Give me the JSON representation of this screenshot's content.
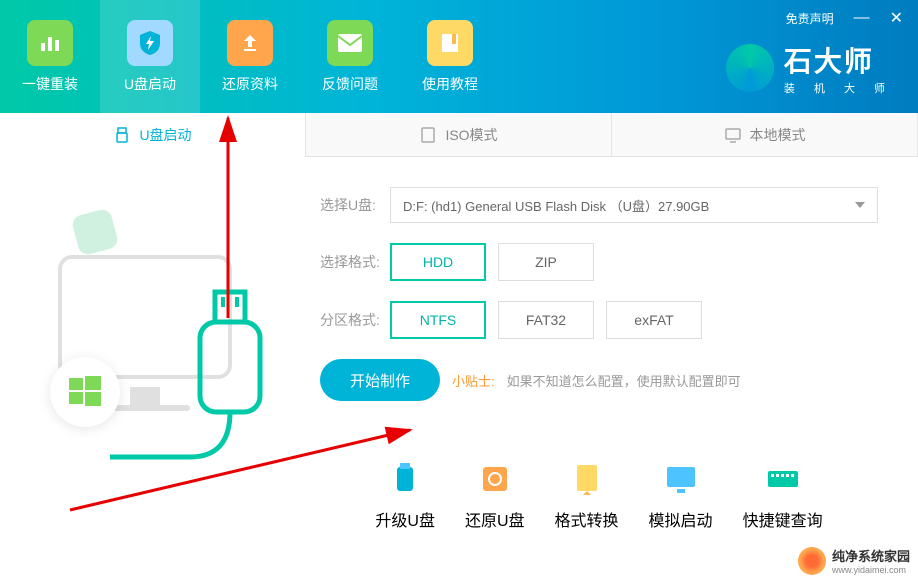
{
  "header": {
    "nav": [
      {
        "label": "一键重装",
        "name": "nav-reinstall"
      },
      {
        "label": "U盘启动",
        "name": "nav-usb-boot"
      },
      {
        "label": "还原资料",
        "name": "nav-restore"
      },
      {
        "label": "反馈问题",
        "name": "nav-feedback"
      },
      {
        "label": "使用教程",
        "name": "nav-tutorial"
      }
    ],
    "disclaimer": "免责声明",
    "brand_title": "石大师",
    "brand_sub": "装 机 大 师"
  },
  "tabs": [
    {
      "label": "U盘启动",
      "name": "tab-usb-boot"
    },
    {
      "label": "ISO模式",
      "name": "tab-iso"
    },
    {
      "label": "本地模式",
      "name": "tab-local"
    }
  ],
  "form": {
    "drive_label": "选择U盘:",
    "drive_value": "D:F: (hd1) General USB Flash Disk （U盘）27.90GB",
    "format_label": "选择格式:",
    "format_options": [
      "HDD",
      "ZIP"
    ],
    "format_selected": "HDD",
    "partition_label": "分区格式:",
    "partition_options": [
      "NTFS",
      "FAT32",
      "exFAT"
    ],
    "partition_selected": "NTFS",
    "start_btn": "开始制作",
    "tip_label": "小贴士:",
    "tip_text": "如果不知道怎么配置，使用默认配置即可"
  },
  "tools": [
    {
      "label": "升级U盘",
      "name": "tool-upgrade",
      "color": "#00b4d8"
    },
    {
      "label": "还原U盘",
      "name": "tool-restore",
      "color": "#ffa64d"
    },
    {
      "label": "格式转换",
      "name": "tool-convert",
      "color": "#ffd966"
    },
    {
      "label": "模拟启动",
      "name": "tool-simulate",
      "color": "#4dc3ff"
    },
    {
      "label": "快捷键查询",
      "name": "tool-hotkey",
      "color": "#00c9a7"
    }
  ],
  "watermark": {
    "title": "纯净系统家园",
    "url": "www.yidaimei.com"
  }
}
